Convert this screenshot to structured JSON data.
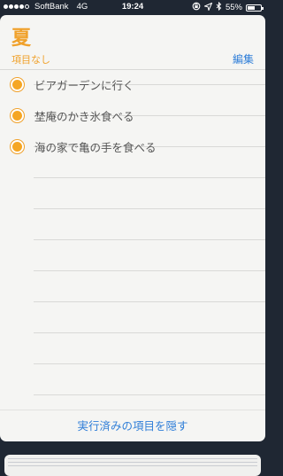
{
  "status_bar": {
    "carrier": "SoftBank",
    "network": "4G",
    "time": "19:24",
    "battery": "55%",
    "battery_level": 0.55,
    "signal_bars_filled": 4,
    "icons": [
      "signal-icon",
      "lock-rotation-icon",
      "location-icon",
      "bluetooth-icon",
      "battery-icon"
    ]
  },
  "list": {
    "title": "夏",
    "no_items_label": "項目なし",
    "edit_label": "編集",
    "accent_color": "#f0a12b",
    "link_color": "#2f7ed8"
  },
  "items": [
    {
      "label": "ビアガーデンに行く"
    },
    {
      "label": "埜庵のかき氷食べる"
    },
    {
      "label": "海の家で亀の手を食べる"
    }
  ],
  "footer": {
    "hide_completed_label": "実行済みの項目を隠す"
  }
}
